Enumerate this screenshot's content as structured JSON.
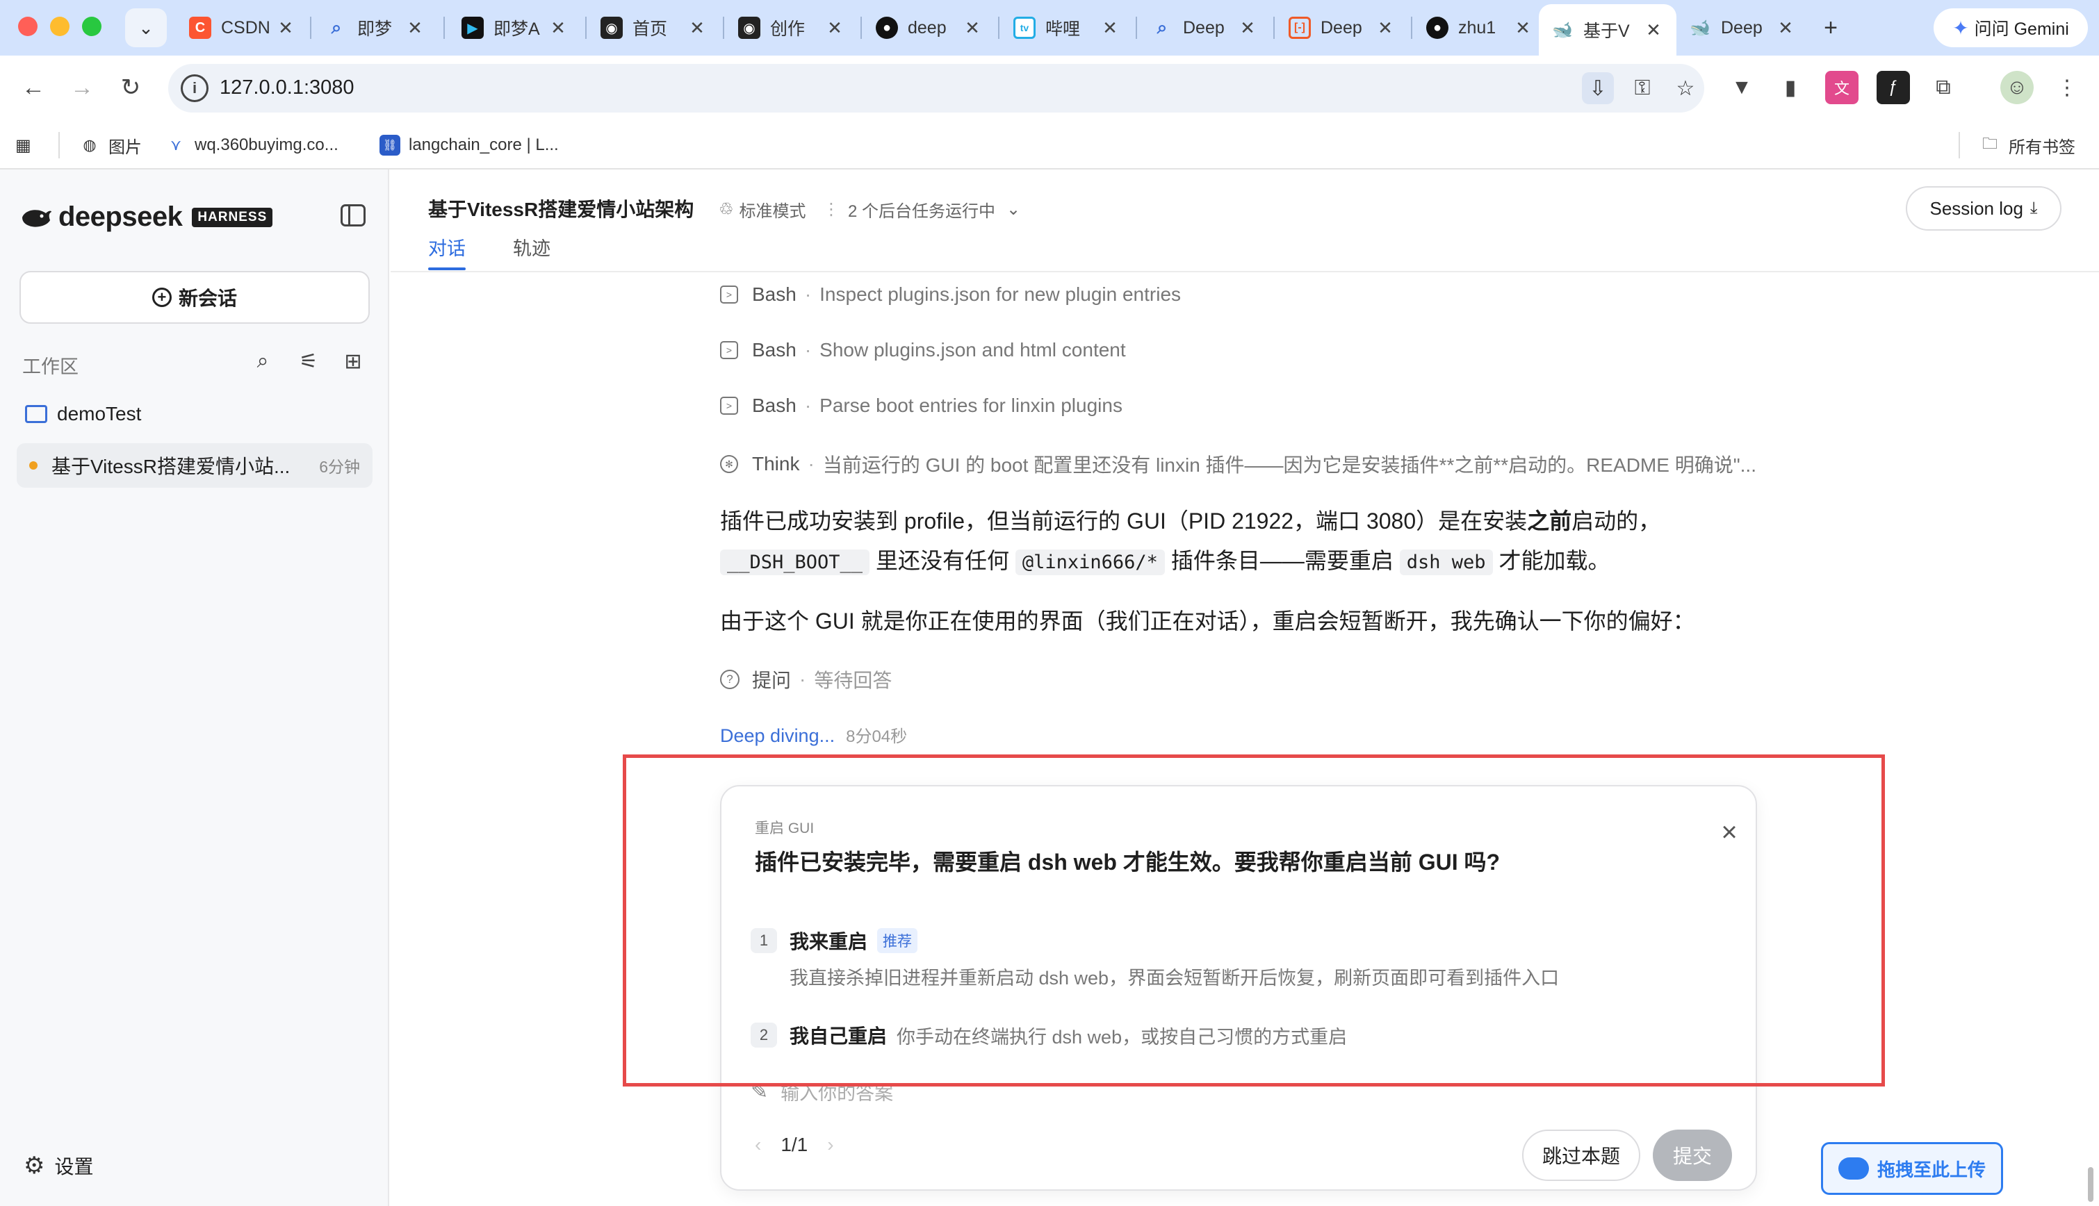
{
  "browser": {
    "tabs": [
      {
        "title": "CSDN",
        "icon": "csdn-icon"
      },
      {
        "title": "即梦",
        "icon": "search-icon"
      },
      {
        "title": "即梦A",
        "icon": "jimeng-icon"
      },
      {
        "title": "首页",
        "icon": "bot-icon"
      },
      {
        "title": "创作",
        "icon": "bot-icon"
      },
      {
        "title": "deep",
        "icon": "github-icon"
      },
      {
        "title": "哔哩",
        "icon": "bilibili-icon"
      },
      {
        "title": "Deep",
        "icon": "search-icon"
      },
      {
        "title": "Deep",
        "icon": "code-icon"
      },
      {
        "title": "zhu1",
        "icon": "github-icon"
      },
      {
        "title": "基于V",
        "icon": "deepseek-icon"
      },
      {
        "title": "Deep",
        "icon": "deepseek-icon"
      }
    ],
    "gemini_label": "问问 Gemini",
    "url": "127.0.0.1:3080",
    "bookmarks": [
      {
        "label": "图片",
        "icon": "globe-icon"
      },
      {
        "label": "wq.360buyimg.co...",
        "icon": "jd-icon"
      },
      {
        "label": "langchain_core | L...",
        "icon": "langchain-icon"
      }
    ],
    "all_bookmarks": "所有书签"
  },
  "sidebar": {
    "logo_text": "deepseek",
    "logo_badge": "HARNESS",
    "new_chat": "新会话",
    "workspace_label": "工作区",
    "folder": "demoTest",
    "session": {
      "title": "基于VitessR搭建爱情小站...",
      "time": "6分钟"
    },
    "settings": "设置"
  },
  "header": {
    "title": "基于VitessR搭建爱情小站架构",
    "mode": "标准模式",
    "bg_tasks": "2 个后台任务运行中",
    "tabs": [
      "对话",
      "轨迹"
    ],
    "session_log": "Session log"
  },
  "content": {
    "tool_rows": [
      {
        "name": "Bash",
        "desc": "Inspect plugins.json for new plugin entries"
      },
      {
        "name": "Bash",
        "desc": "Show plugins.json and html content"
      },
      {
        "name": "Bash",
        "desc": "Parse boot entries for linxin plugins"
      },
      {
        "name": "Think",
        "desc": "当前运行的 GUI 的 boot 配置里还没有 linxin 插件——因为它是安装插件**之前**启动的。README 明确说\"..."
      }
    ],
    "para1": {
      "a": "插件已成功安装到 profile，但当前运行的 GUI（PID 21922，端口 3080）是在安装",
      "b": "之前",
      "c": "启动的，",
      "code1": "__DSH_BOOT__",
      "d": " 里还没有任何 ",
      "code2": "@linxin666/*",
      "e": " 插件条目——需要重启 ",
      "code3": "dsh web",
      "f": " 才能加载。"
    },
    "para2": "由于这个 GUI 就是你正在使用的界面（我们正在对话），重启会短暂断开，我先确认一下你的偏好：",
    "ask": {
      "label": "提问",
      "status": "等待回答"
    },
    "deep": {
      "label": "Deep diving...",
      "time": "8分04秒"
    }
  },
  "card": {
    "tag": "重启 GUI",
    "question": "插件已安装完毕，需要重启 dsh web 才能生效。要我帮你重启当前 GUI 吗?",
    "options": [
      {
        "num": "1",
        "title": "我来重启",
        "badge": "推荐",
        "desc": "我直接杀掉旧进程并重新启动 dsh web，界面会短暂断开后恢复，刷新页面即可看到插件入口"
      },
      {
        "num": "2",
        "title": "我自己重启",
        "desc": "你手动在终端执行 dsh web，或按自己习惯的方式重启"
      }
    ],
    "answer_placeholder": "输入你的答案",
    "pager": "1/1",
    "skip": "跳过本题",
    "submit": "提交"
  },
  "upload": {
    "label": "拖拽至此上传"
  },
  "colors": {
    "accent": "#3b6fd8",
    "highlight": "#e64a4a",
    "tabbar": "#d3e3fd"
  }
}
